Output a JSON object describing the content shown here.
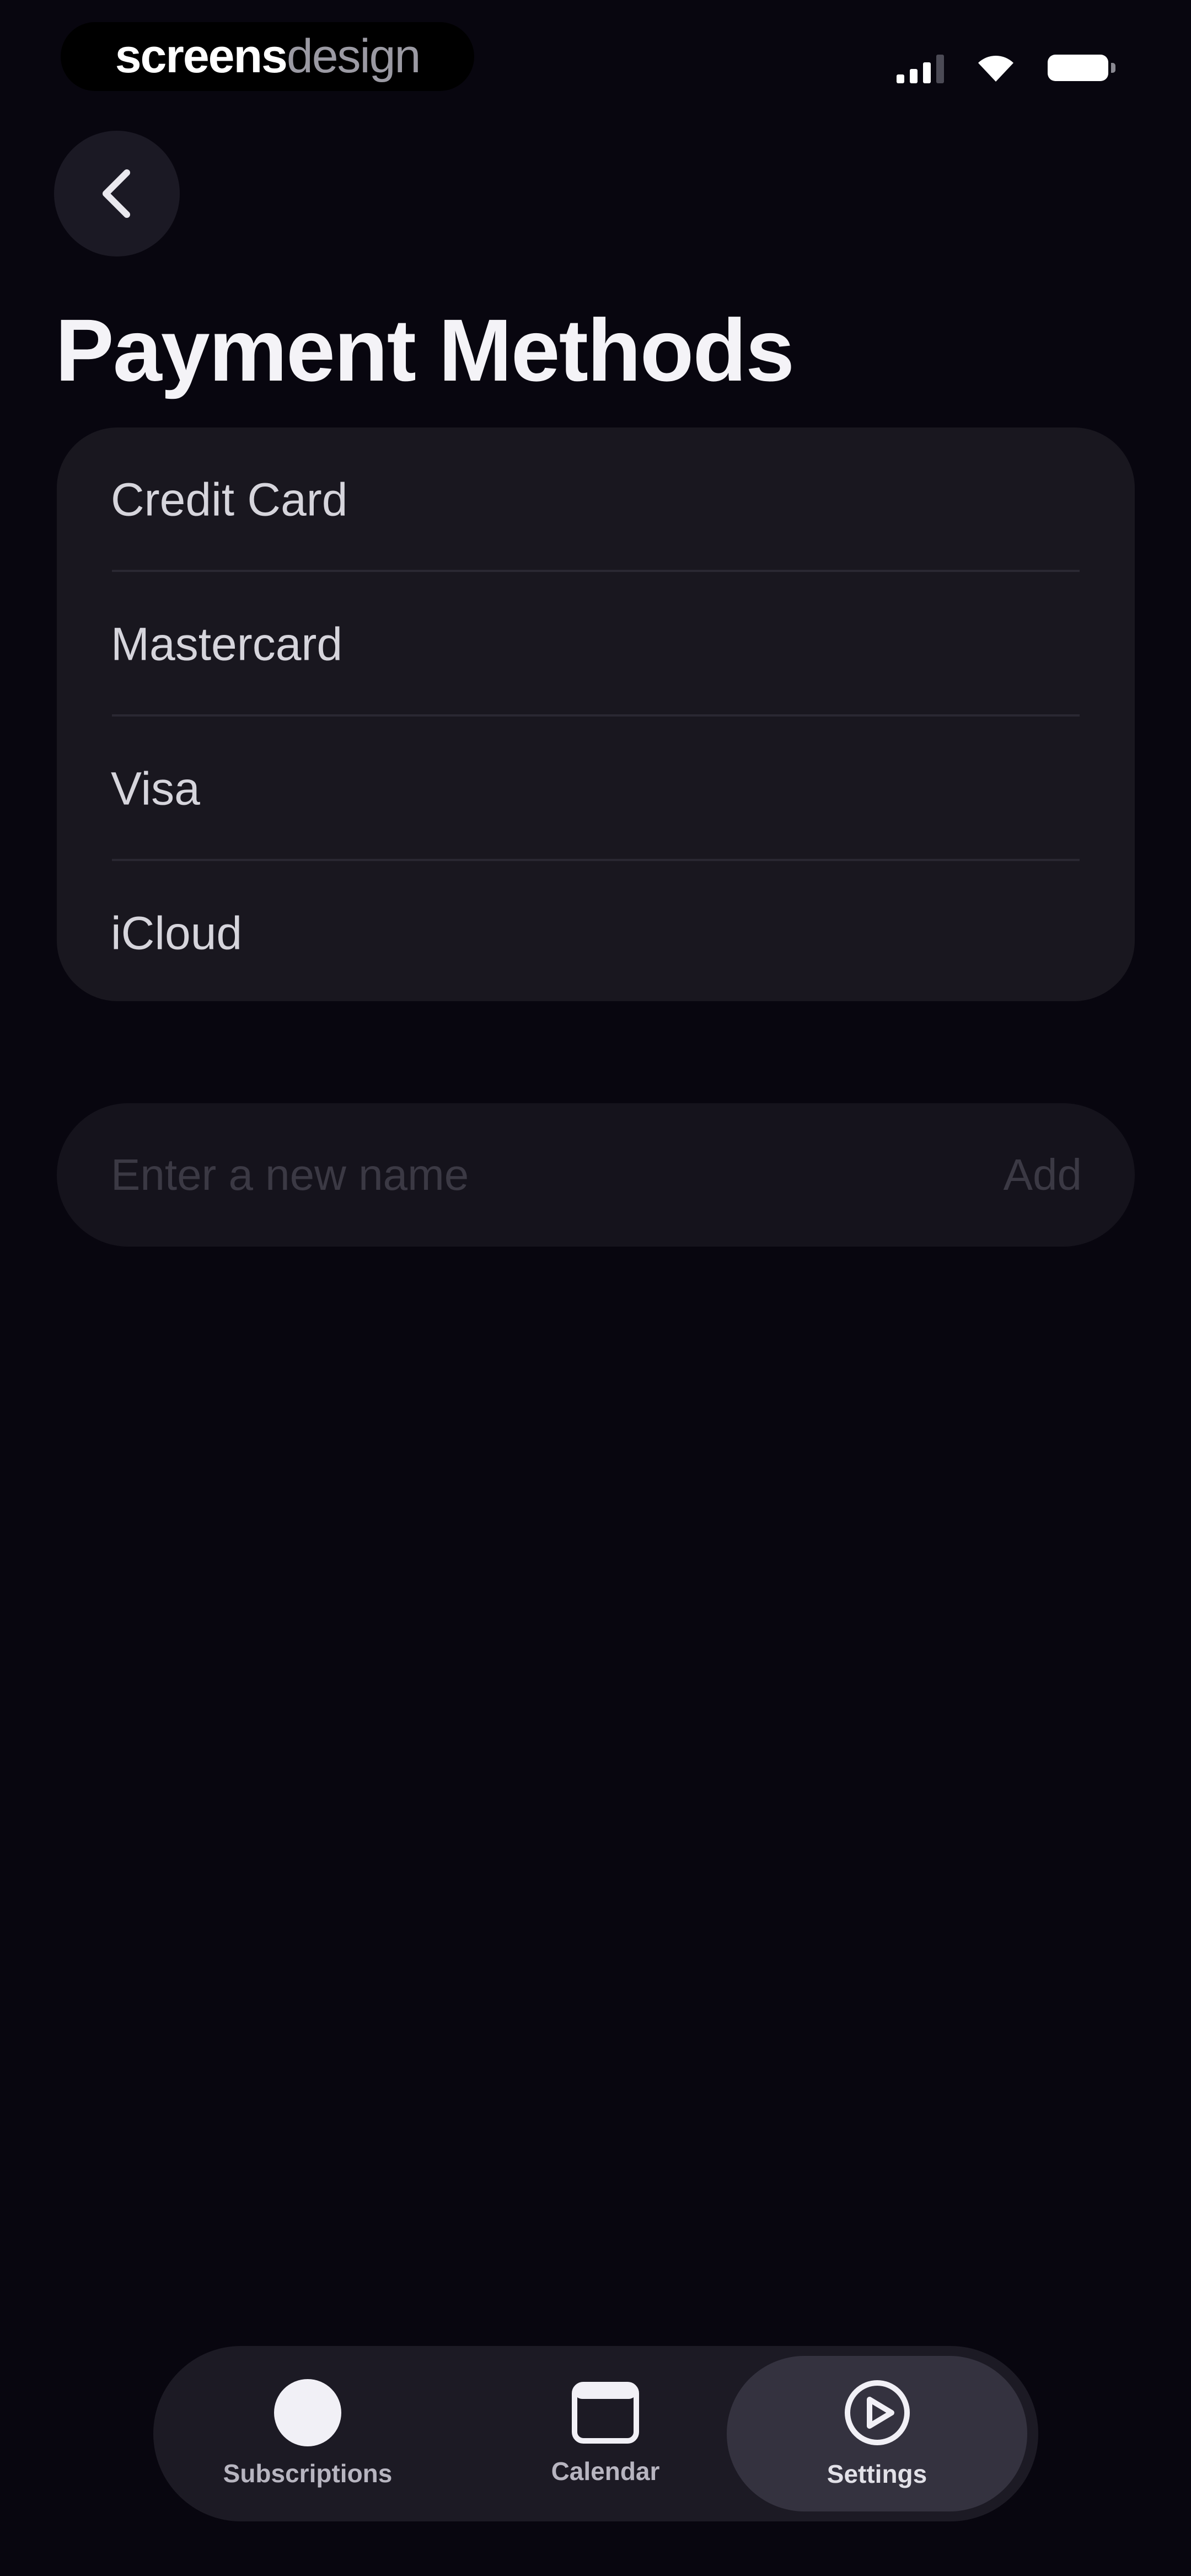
{
  "status_bar": {
    "brand_bold": "screens",
    "brand_light": "design",
    "icons": [
      "cellular-signal-icon",
      "wifi-icon",
      "battery-icon"
    ]
  },
  "header": {
    "back_icon": "chevron-left-icon",
    "title": "Payment Methods"
  },
  "payment_methods": [
    {
      "label": "Credit Card"
    },
    {
      "label": "Mastercard"
    },
    {
      "label": "Visa"
    },
    {
      "label": "iCloud"
    }
  ],
  "add_form": {
    "placeholder": "Enter a new name",
    "value": "",
    "button_label": "Add"
  },
  "tab_bar": {
    "tabs": [
      {
        "label": "Subscriptions",
        "icon": "circle-icon",
        "active": false
      },
      {
        "label": "Calendar",
        "icon": "calendar-icon",
        "active": false
      },
      {
        "label": "Settings",
        "icon": "play-circle-icon",
        "active": true
      }
    ]
  },
  "colors": {
    "background": "#08060f",
    "card": "#19171f",
    "text_primary": "#f4f3f7",
    "text_secondary": "#d6d5dc",
    "placeholder": "#3b3944",
    "tab_active_bg": "#34323f"
  }
}
